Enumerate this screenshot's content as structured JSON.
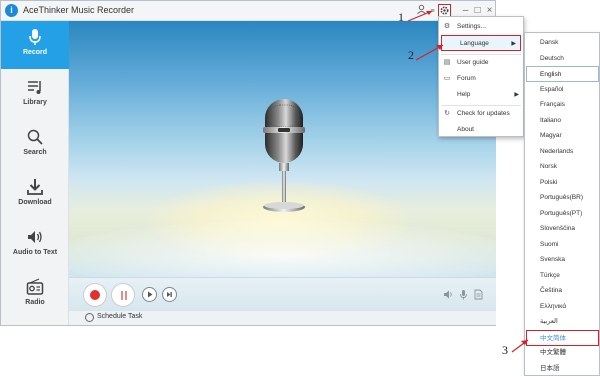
{
  "app": {
    "title": "AceThinker Music Recorder",
    "logo_letter": "i"
  },
  "titlebar": {
    "user_icon": "user-icon",
    "gear_icon": "gear-icon",
    "minimize_icon": "minimize-icon",
    "maximize_icon": "maximize-icon",
    "close_icon": "close-icon"
  },
  "sidebar": {
    "items": [
      {
        "label": "Record",
        "icon": "microphone-icon",
        "active": true
      },
      {
        "label": "Library",
        "icon": "music-list-icon",
        "active": false
      },
      {
        "label": "Search",
        "icon": "search-icon",
        "active": false
      },
      {
        "label": "Download",
        "icon": "download-icon",
        "active": false
      },
      {
        "label": "Audio to Text",
        "icon": "speaker-text-icon",
        "active": false
      },
      {
        "label": "Radio",
        "icon": "radio-icon",
        "active": false
      }
    ]
  },
  "statusbar": {
    "schedule_label": "Schedule Task"
  },
  "menu": {
    "items": [
      {
        "label": "Settings...",
        "icon": "gear-icon"
      },
      {
        "label": "Language",
        "icon": "",
        "has_submenu": true
      },
      {
        "label": "User guide",
        "icon": "book-icon"
      },
      {
        "label": "Forum",
        "icon": "chat-icon"
      },
      {
        "label": "Help",
        "icon": "",
        "has_submenu": true
      },
      {
        "label": "Check for updates",
        "icon": "refresh-icon"
      },
      {
        "label": "About",
        "icon": ""
      }
    ],
    "arrow_glyph": "▶"
  },
  "languages": {
    "items": [
      "Dansk",
      "Deutsch",
      "English",
      "Español",
      "Français",
      "Italiano",
      "Magyar",
      "Nederlands",
      "Norsk",
      "Polski",
      "Português(BR)",
      "Português(PT)",
      "Slovenščina",
      "Suomi",
      "Svenska",
      "Türkçe",
      "Čeština",
      "Ελληνικά",
      "العربية",
      "中文简体",
      "中文繁體",
      "日本語"
    ],
    "selected": "English",
    "highlighted": "中文简体"
  },
  "annotations": {
    "step1": "1",
    "step2": "2",
    "step3": "3"
  },
  "colors": {
    "accent": "#24a0e6",
    "annotation_red": "#d8202a",
    "record_red": "#e0302f"
  }
}
